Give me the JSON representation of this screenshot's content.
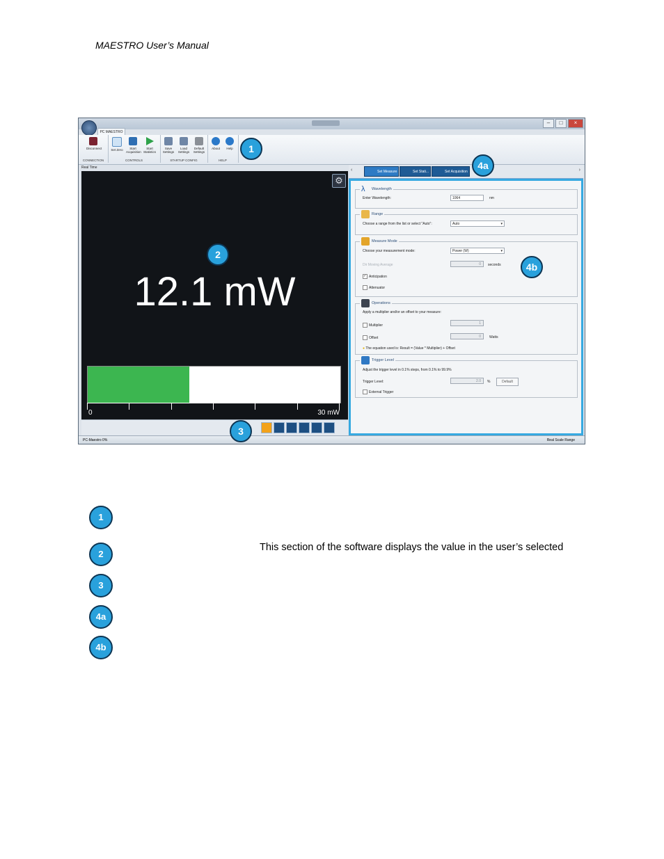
{
  "document": {
    "header": "MAESTRO User’s Manual",
    "legend_description": "This section of the software displays the value in the user’s selected"
  },
  "screenshot": {
    "window_controls": [
      "–",
      "□",
      "×"
    ],
    "app_tab": "PC MAESTRO",
    "ribbon": {
      "groups": [
        {
          "label": "CONNECTION",
          "items": [
            {
              "label": "Disconnect",
              "icon": "disconnect-icon"
            }
          ]
        },
        {
          "label": "CONTROLS",
          "items": [
            {
              "label": "Set Zero",
              "icon": "zero-icon"
            },
            {
              "label": "Start Acquisition",
              "icon": "acquisition-icon"
            },
            {
              "label": "Start Statistics",
              "icon": "play-icon"
            }
          ]
        },
        {
          "label": "STARTUP CONFIG",
          "items": [
            {
              "label": "Save Settings",
              "icon": "tools-icon"
            },
            {
              "label": "Load Settings",
              "icon": "tools-icon"
            },
            {
              "label": "Default Settings",
              "icon": "tools-icon"
            }
          ]
        },
        {
          "label": "HELP",
          "items": [
            {
              "label": "About",
              "icon": "info-icon"
            },
            {
              "label": "Help",
              "icon": "help-icon"
            }
          ]
        }
      ]
    },
    "left_label": "Real Time",
    "reading": "12.1 mW",
    "bar": {
      "fraction": 0.403,
      "min_label": "0",
      "max_label": "30 mW",
      "ticks": 7
    },
    "status_left": "PC-Maestro 0%",
    "status_right": "Real Scale Range",
    "tabs": [
      {
        "label": "Set Measure",
        "active": true
      },
      {
        "label": "Set Stati...",
        "active": false
      },
      {
        "label": "Set Acquisition",
        "active": false
      }
    ],
    "wavelength": {
      "title": "Wavelength",
      "label": "Enter Wavelength:",
      "value": "1064",
      "unit": "nm"
    },
    "range": {
      "title": "Range",
      "label": "Choose a range from the list or select \"Auto\":",
      "value": "Auto"
    },
    "measure_mode": {
      "title": "Measure Mode",
      "label": "Choose your measurement mode:",
      "value": "Power (W)",
      "averaging_label": "Dir Moving Average",
      "averaging_value": "0",
      "averaging_unit": "seconds",
      "anticipation": "Anticipation",
      "attenuator": "Attenuator"
    },
    "operations": {
      "title": "Operations",
      "label": "Apply a multiplier and/or an offset to your measure:",
      "multiplier_label": "Multiplier",
      "multiplier_value": "1",
      "offset_label": "Offset",
      "offset_value": "0",
      "offset_unit": "Watts",
      "equation": "The equation used is: Result = (Value * Multiplier) + Offset"
    },
    "trigger": {
      "title": "Trigger Level",
      "label": "Adjust the trigger level in 0.1% steps, from 0.1% to 99.9%",
      "level_label": "Trigger Level:",
      "level_value": "2.0",
      "level_unit": "%",
      "default_button": "Default",
      "external_label": "External Trigger"
    },
    "callouts": {
      "c1": "1",
      "c2": "2",
      "c3": "3",
      "c4a": "4a",
      "c4b": "4b"
    }
  },
  "legend": [
    "1",
    "2",
    "3",
    "4a",
    "4b"
  ]
}
